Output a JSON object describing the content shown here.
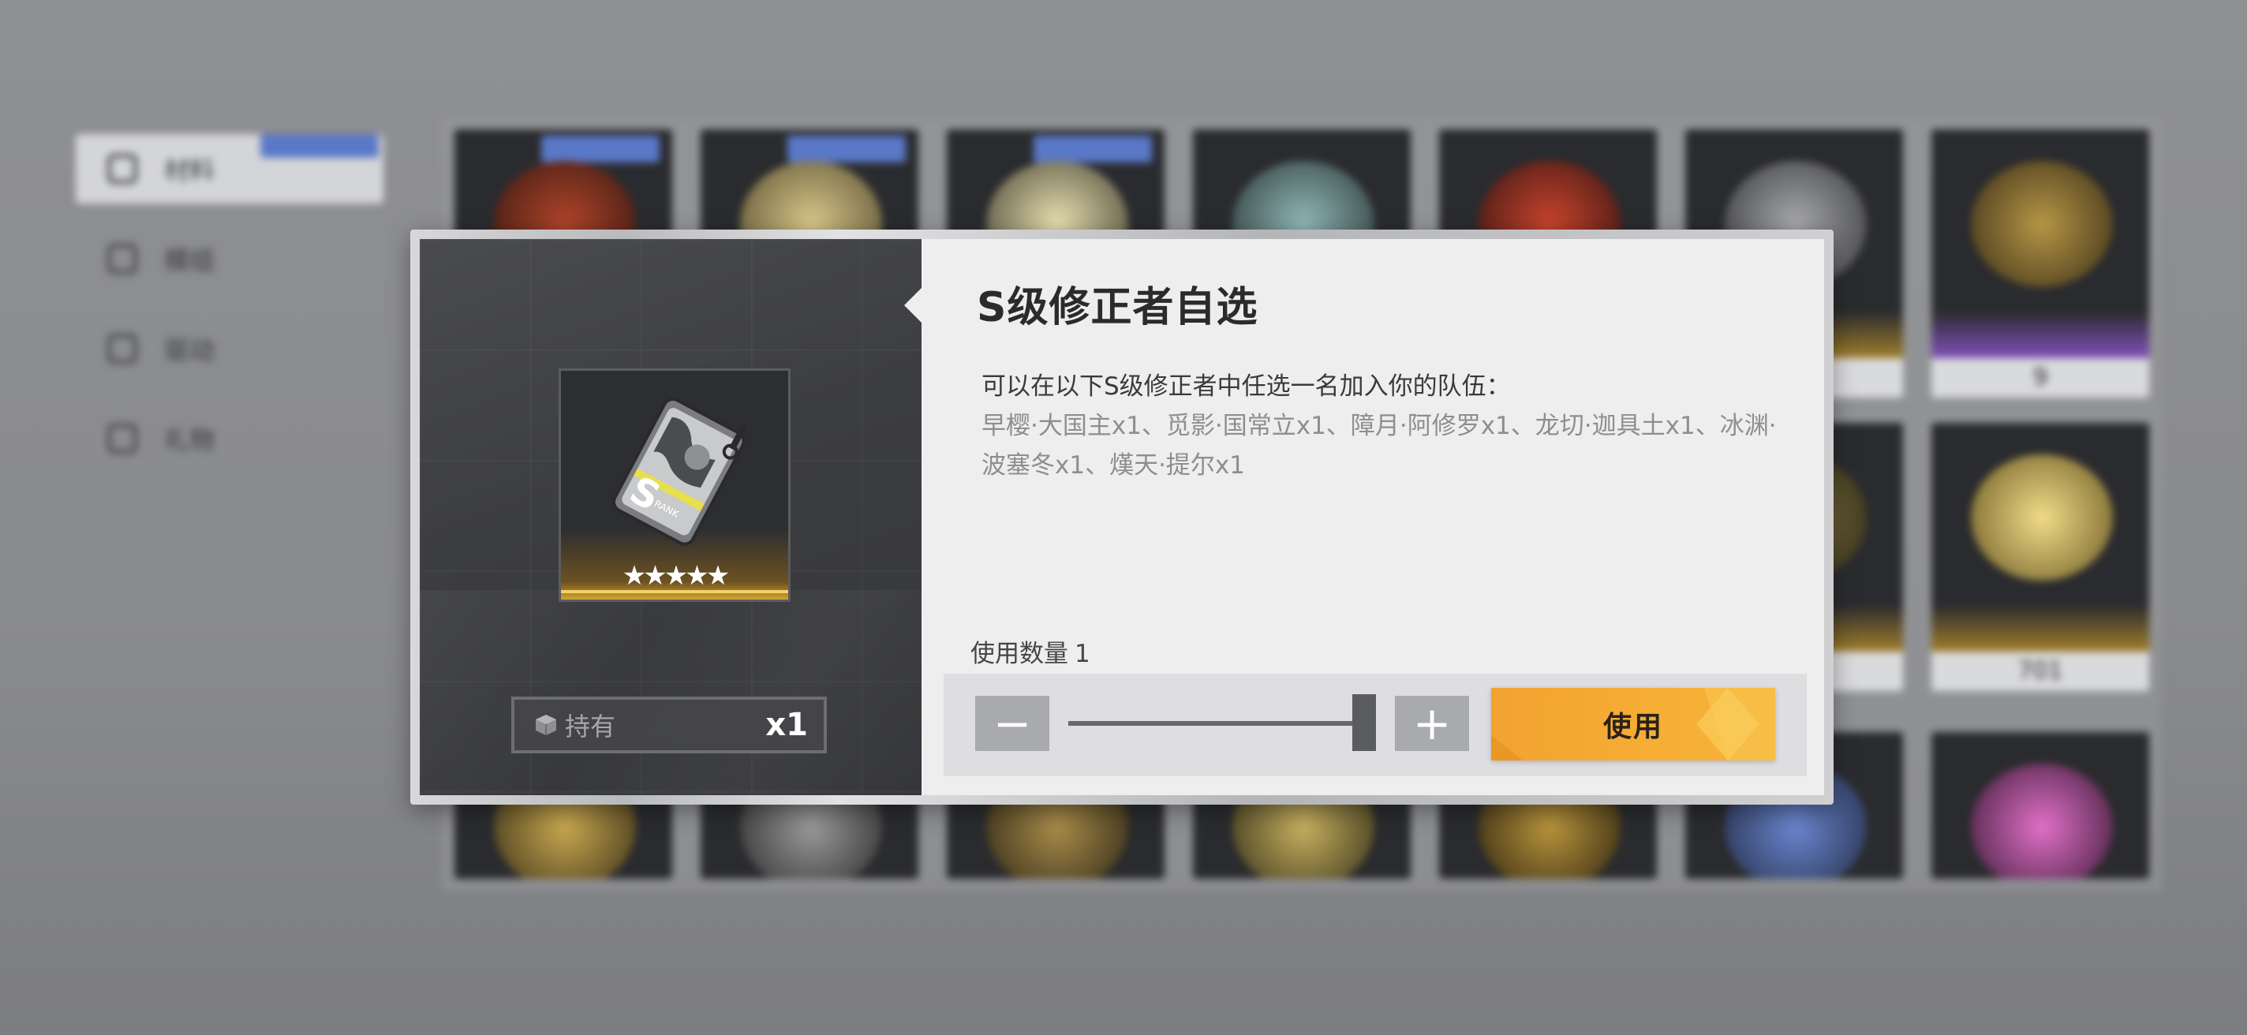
{
  "background": {
    "sidebar": {
      "items": [
        {
          "label": "材料",
          "active": true
        },
        {
          "label": "模组",
          "active": false
        },
        {
          "label": "驱动",
          "active": false
        },
        {
          "label": "礼物",
          "active": false
        }
      ]
    },
    "grid_counts": [
      "9",
      "701"
    ]
  },
  "dialog": {
    "title": "S级修正者自选",
    "description": "可以在以下S级修正者中任选一名加入你的队伍：",
    "candidates": "早樱·大国主x1、觅影·国常立x1、障月·阿修罗x1、龙切·迦具土x1、冰渊·波塞冬x1、熯天·提尔x1",
    "item": {
      "stars": "★★★★★",
      "rank_letter": "S",
      "rank_text": "RANK"
    },
    "owned": {
      "label": "持有",
      "count": "x1",
      "icon": "box-icon"
    },
    "quantity": {
      "label": "使用数量",
      "value": "1",
      "slider_fraction": 1.0
    },
    "buttons": {
      "minus": "−",
      "plus": "+",
      "use": "使用"
    }
  },
  "colors": {
    "accent": "#F5A833",
    "panel_dark": "#3C3D40",
    "panel_light": "#EEEEEE",
    "star_glow": "#F2D267"
  }
}
